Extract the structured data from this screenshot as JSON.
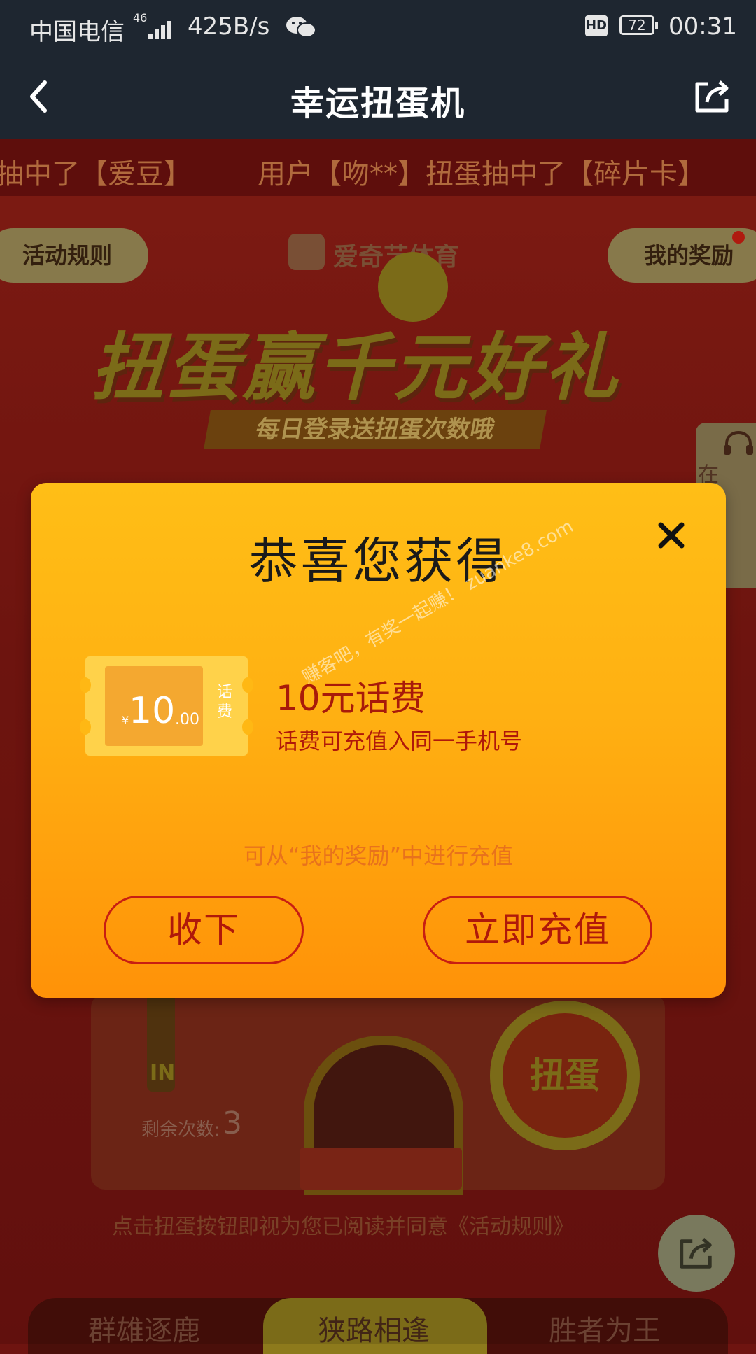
{
  "status_bar": {
    "carrier": "中国电信",
    "network": "46",
    "speed": "425B/s",
    "hd": "HD",
    "battery": "72",
    "time": "00:31"
  },
  "app_bar": {
    "title": "幸运扭蛋机"
  },
  "ticker": {
    "items": [
      "抽中了【爱豆】",
      "用户【吻**】扭蛋抽中了【碎片卡】"
    ]
  },
  "page": {
    "rules_button": "活动规则",
    "my_rewards_button": "我的奖励",
    "brand": "爱奇艺体育",
    "banner_title": "扭蛋赢千元好礼",
    "banner_subtitle": "每日登录送扭蛋次数哦",
    "side_service": "在线客服",
    "in_label": "IN",
    "twist_button": "扭蛋",
    "remaining_label": "剩余次数:",
    "remaining_count": "3",
    "agreement": "点击扭蛋按钮即视为您已阅读并同意《活动规则》",
    "bottom_tabs": [
      "群雄逐鹿",
      "狭路相逢",
      "胜者为王"
    ]
  },
  "modal": {
    "title": "恭喜您获得",
    "coupon": {
      "currency": "¥",
      "amount": "10",
      "cents": ".00",
      "tag": "话费"
    },
    "prize_name": "10元话费",
    "prize_desc": "话费可充值入同一手机号",
    "hint": "可从“我的奖励”中进行充值",
    "accept_button": "收下",
    "recharge_button": "立即充值",
    "watermark": "赚客吧，有奖一起赚！ zuanke8.com"
  },
  "colors": {
    "status_bg": "#1e2630",
    "modal_top": "#ffbe16",
    "modal_bottom": "#ff9208",
    "accent_red": "#b0180a"
  }
}
